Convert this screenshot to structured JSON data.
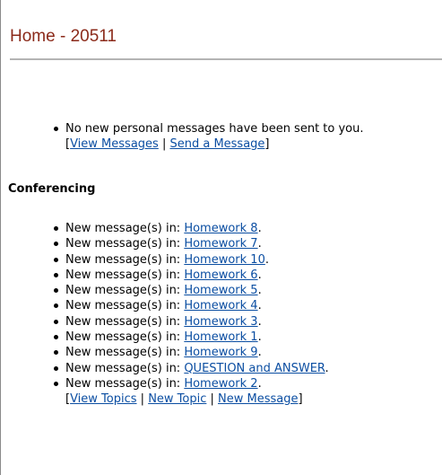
{
  "header": {
    "title": "Home - 20511"
  },
  "personal_messages": {
    "status_text": "No new personal messages have been sent to you.",
    "links": {
      "open_bracket": "[",
      "view_messages": "View Messages",
      "separator": " | ",
      "send_message": "Send a Message",
      "close_bracket": "]"
    }
  },
  "conferencing": {
    "heading": "Conferencing",
    "item_prefix": "New message(s) in: ",
    "item_suffix": ".",
    "items": [
      {
        "topic": "Homework 8"
      },
      {
        "topic": "Homework 7"
      },
      {
        "topic": "Homework 10"
      },
      {
        "topic": "Homework 6"
      },
      {
        "topic": "Homework 5"
      },
      {
        "topic": "Homework 4"
      },
      {
        "topic": "Homework 3"
      },
      {
        "topic": "Homework 1"
      },
      {
        "topic": "Homework 9"
      },
      {
        "topic": "QUESTION and ANSWER"
      },
      {
        "topic": "Homework 2"
      }
    ],
    "links": {
      "open_bracket": "[",
      "view_topics": "View Topics",
      "separator_1": " | ",
      "new_topic": "New Topic",
      "separator_2": " | ",
      "new_message": "New Message",
      "close_bracket": "]"
    }
  }
}
